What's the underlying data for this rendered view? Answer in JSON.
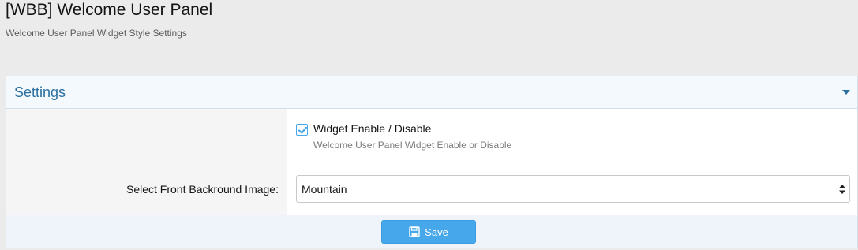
{
  "page": {
    "title": "[WBB] Welcome User Panel",
    "subtitle": "Welcome User Panel Widget Style Settings"
  },
  "block": {
    "title": "Settings",
    "toggle_icon": "triangle-down-icon"
  },
  "widget_enable": {
    "checked": true,
    "label": "Widget Enable / Disable",
    "hint": "Welcome User Panel Widget Enable or Disable"
  },
  "background_image": {
    "label": "Select Front Backround Image:",
    "value": "Mountain"
  },
  "footer": {
    "save_label": "Save",
    "save_icon": "floppy-disk-icon"
  },
  "colors": {
    "accent": "#47a7eb",
    "block_title": "#2b70a0",
    "header_bg": "#f4f9fd",
    "footer_bg": "#eef4fa"
  }
}
